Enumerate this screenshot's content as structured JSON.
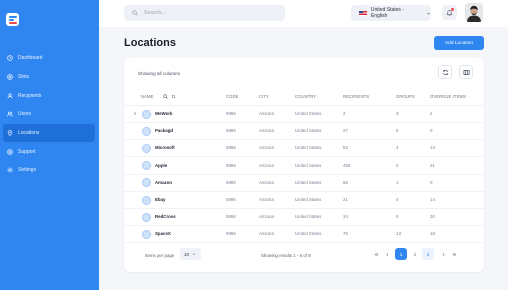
{
  "sidebar": {
    "items": [
      {
        "label": "Dashboard",
        "icon": "clock-icon"
      },
      {
        "label": "Slots",
        "icon": "target-icon"
      },
      {
        "label": "Recipients",
        "icon": "user-icon"
      },
      {
        "label": "Users",
        "icon": "users-icon"
      },
      {
        "label": "Locations",
        "icon": "location-icon",
        "active": true
      },
      {
        "label": "Support",
        "icon": "support-icon"
      },
      {
        "label": "Settings",
        "icon": "gear-icon"
      }
    ]
  },
  "topbar": {
    "search_placeholder": "Search...",
    "language": "United States - English"
  },
  "page": {
    "title": "Locations",
    "add_button": "Add Location"
  },
  "table": {
    "showing_label": "Showing all columns",
    "columns": [
      "NAME",
      "CODE",
      "CITY",
      "COUNTRY",
      "RECIPIENTS",
      "GROUPS",
      "OVERDUE ITEMS"
    ],
    "rows": [
      [
        "WeWork",
        "5996",
        "Arizona",
        "United States",
        "2",
        "3",
        "2"
      ],
      [
        "Packagd",
        "5996",
        "Arizona",
        "United States",
        "27",
        "5",
        "0"
      ],
      [
        "Microsoft",
        "5996",
        "Arizona",
        "United States",
        "52",
        "4",
        "13"
      ],
      [
        "Apple",
        "5996",
        "Arizona",
        "United States",
        "456",
        "2",
        "21"
      ],
      [
        "Amazon",
        "5996",
        "Arizona",
        "United States",
        "66",
        "1",
        "0"
      ],
      [
        "Ebay",
        "5996",
        "Arizona",
        "United States",
        "21",
        "4",
        "14"
      ],
      [
        "RedCross",
        "5996",
        "Arizona",
        "United States",
        "34",
        "6",
        "30"
      ],
      [
        "SpaceX",
        "5996",
        "Arizona",
        "United States",
        "76",
        "13",
        "18"
      ]
    ]
  },
  "footer": {
    "items_per_page_label": "Items per page",
    "items_per_page_value": "10",
    "results_text": "Showing results 1 - 8 of 8",
    "pages": [
      "1",
      "2",
      "3"
    ]
  },
  "colors": {
    "primary": "#2f86f0",
    "sidebar": "#2f86f0",
    "notification": "#ef4b4b"
  }
}
